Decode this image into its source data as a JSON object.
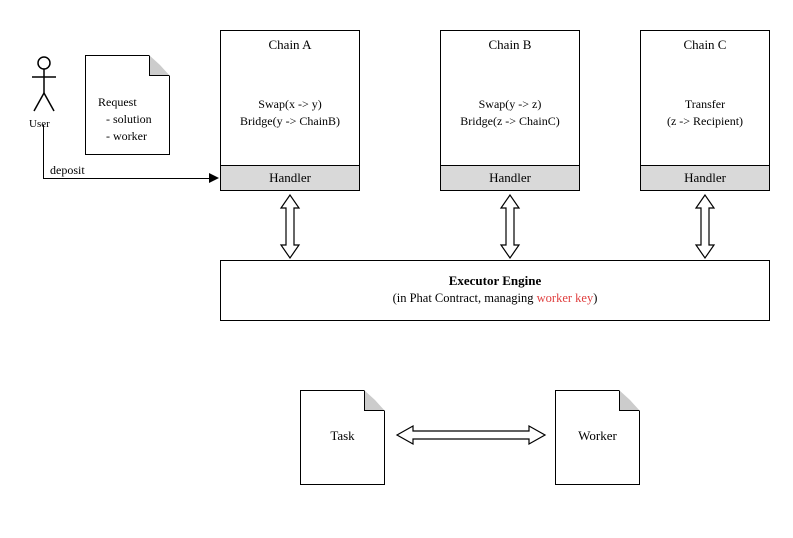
{
  "user": {
    "label": "User"
  },
  "request": {
    "title": "Request",
    "item1": "- solution",
    "item2": "- worker"
  },
  "deposit": {
    "label": "deposit"
  },
  "chain_a": {
    "title": "Chain A",
    "line1": "Swap(x -> y)",
    "line2": "Bridge(y -> ChainB)",
    "handler": "Handler"
  },
  "chain_b": {
    "title": "Chain B",
    "line1": "Swap(y -> z)",
    "line2": "Bridge(z -> ChainC)",
    "handler": "Handler"
  },
  "chain_c": {
    "title": "Chain C",
    "line1": "Transfer",
    "line2": "(z -> Recipient)",
    "handler": "Handler"
  },
  "executor": {
    "title": "Executor Engine",
    "sub_prefix": "(in Phat Contract, managing ",
    "sub_highlight": "worker key",
    "sub_suffix": ")"
  },
  "task": {
    "label": "Task"
  },
  "worker": {
    "label": "Worker"
  }
}
